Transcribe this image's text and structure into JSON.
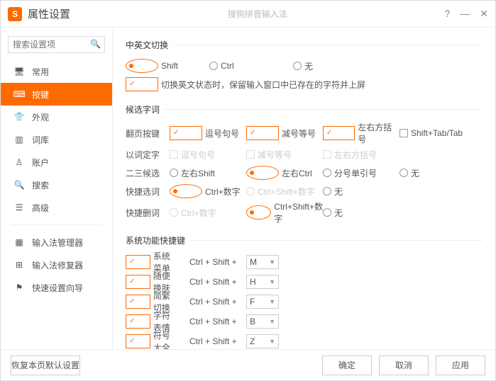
{
  "titlebar": {
    "title": "属性设置",
    "subtitle": "搜狗拼音输入法"
  },
  "search": {
    "placeholder": "搜索设置项"
  },
  "sidebar": {
    "items": [
      {
        "label": "常用"
      },
      {
        "label": "按键"
      },
      {
        "label": "外观"
      },
      {
        "label": "词库"
      },
      {
        "label": "账户"
      },
      {
        "label": "搜索"
      },
      {
        "label": "高级"
      }
    ],
    "extra": [
      {
        "label": "输入法管理器"
      },
      {
        "label": "输入法修复器"
      },
      {
        "label": "快速设置向导"
      }
    ]
  },
  "sections": {
    "s1": "中英文切换",
    "s2": "候选字词",
    "s3": "系统功能快捷键"
  },
  "en_cn": {
    "opts": [
      "Shift",
      "Ctrl",
      "无"
    ],
    "keep": "切换英文状态时，保留输入窗口中已存在的字符并上屏"
  },
  "cand": {
    "labels": {
      "page": "翻页按键",
      "word": "以词定字",
      "two3": "二三候选",
      "qsel": "快捷选词",
      "qdel": "快捷删词"
    },
    "page_opts": [
      "逗号句号",
      "减号等号",
      "左右方括号",
      "Shift+Tab/Tab"
    ],
    "word_opts": [
      "逗号句号",
      "减号等号",
      "左右方括号"
    ],
    "two3_opts": [
      "左右Shift",
      "左右Ctrl",
      "分号单引号",
      "无"
    ],
    "qsel_opts": [
      "Ctrl+数字",
      "Ctrl+Shift+数字",
      "无"
    ],
    "qdel_opts": [
      "Ctrl+数字",
      "Ctrl+Shift+数字",
      "无"
    ]
  },
  "shortcuts": {
    "prefix": "Ctrl + Shift +",
    "rows": [
      {
        "label": "系统菜单",
        "key": "M"
      },
      {
        "label": "随便换肤",
        "key": "H"
      },
      {
        "label": "简繁切换",
        "key": "F"
      },
      {
        "label": "字符表情",
        "key": "B"
      },
      {
        "label": "符号大全",
        "key": "Z"
      }
    ]
  },
  "footer": {
    "restore": "恢复本页默认设置",
    "ok": "确定",
    "cancel": "取消",
    "apply": "应用"
  }
}
